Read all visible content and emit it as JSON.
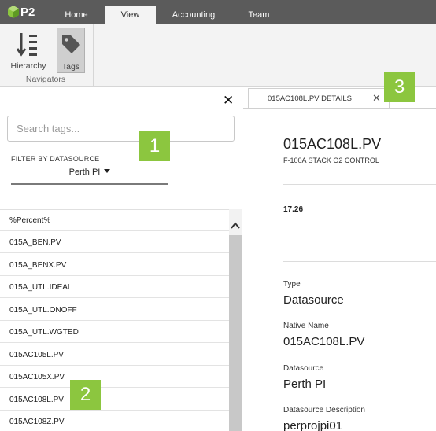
{
  "app": {
    "logo_text": "P2"
  },
  "nav": {
    "tabs": [
      {
        "label": "Home"
      },
      {
        "label": "View"
      },
      {
        "label": "Accounting"
      },
      {
        "label": "Team"
      }
    ]
  },
  "ribbon": {
    "buttons": [
      {
        "label": "Hierarchy"
      },
      {
        "label": "Tags"
      }
    ],
    "group_label": "Navigators"
  },
  "left": {
    "search_placeholder": "Search tags...",
    "filter_label": "FILTER BY DATASOURCE",
    "datasource_selected": "Perth PI",
    "tags": [
      "%Percent%",
      "015A_BEN.PV",
      "015A_BENX.PV",
      "015A_UTL.IDEAL",
      "015A_UTL.ONOFF",
      "015A_UTL.WGTED",
      "015AC105L.PV",
      "015AC105X.PV",
      "015AC108L.PV",
      "015AC108Z.PV"
    ]
  },
  "details": {
    "tab_label": "015AC108L.PV DETAILS",
    "title": "015AC108L.PV",
    "description": "F-100A STACK O2 CONTROL",
    "value": "17.26",
    "fields": [
      {
        "label": "Type",
        "value": "Datasource"
      },
      {
        "label": "Native Name",
        "value": "015AC108L.PV"
      },
      {
        "label": "Datasource",
        "value": "Perth PI"
      },
      {
        "label": "Datasource Description",
        "value": "perprojpi01"
      }
    ]
  },
  "callouts": [
    "1",
    "2",
    "3"
  ],
  "colors": {
    "topbar": "#5b5b5b",
    "callout": "#8cc63f",
    "ribbon": "#f3f3f3"
  }
}
